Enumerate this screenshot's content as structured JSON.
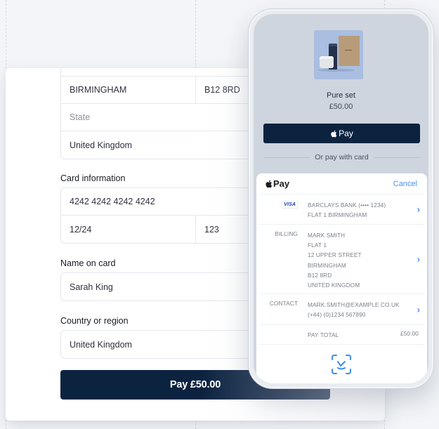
{
  "form": {
    "address": {
      "city": "BIRMINGHAM",
      "postcode": "B12 8RD",
      "state_placeholder": "State",
      "country": "United Kingdom"
    },
    "card_info": {
      "label": "Card information",
      "number": "4242 4242 4242 4242",
      "expiry": "12/24",
      "cvc": "123"
    },
    "name_on_card": {
      "label": "Name on card",
      "value": "Sarah King"
    },
    "country_region": {
      "label": "Country or region",
      "value": "United Kingdom"
    },
    "pay_button": "Pay £50.00"
  },
  "phone": {
    "product": {
      "name": "Pure set",
      "price": "£50.00"
    },
    "apple_pay_button": "Pay",
    "divider_text": "Or pay with card",
    "sheet": {
      "brand": "Pay",
      "cancel": "Cancel",
      "card": {
        "network": "VISA",
        "line1": "BARCLAYS BANK (•••• 1234)",
        "line2": "FLAT 1 BIRMINGHAM"
      },
      "billing": {
        "label": "BILLING",
        "lines": [
          "MARK SMITH",
          "FLAT 1",
          "12 UPPER STREET",
          "BIRMINGHAM",
          "B12 8RD",
          "UNITED KINGDOM"
        ]
      },
      "contact": {
        "label": "CONTACT",
        "email": "MARK.SMITH@EXAMPLE.CO.UK",
        "phone": "(+44) (0)1234 567890"
      },
      "total": {
        "label": "PAY TOTAL",
        "amount": "£50.00"
      },
      "icons": {
        "apple": "apple-logo-icon",
        "chevron": "chevron-right-icon",
        "faceid": "face-id-icon"
      }
    }
  },
  "colors": {
    "primary": "#0c2340",
    "link": "#4d8ef0",
    "background": "#f3f5f8"
  }
}
